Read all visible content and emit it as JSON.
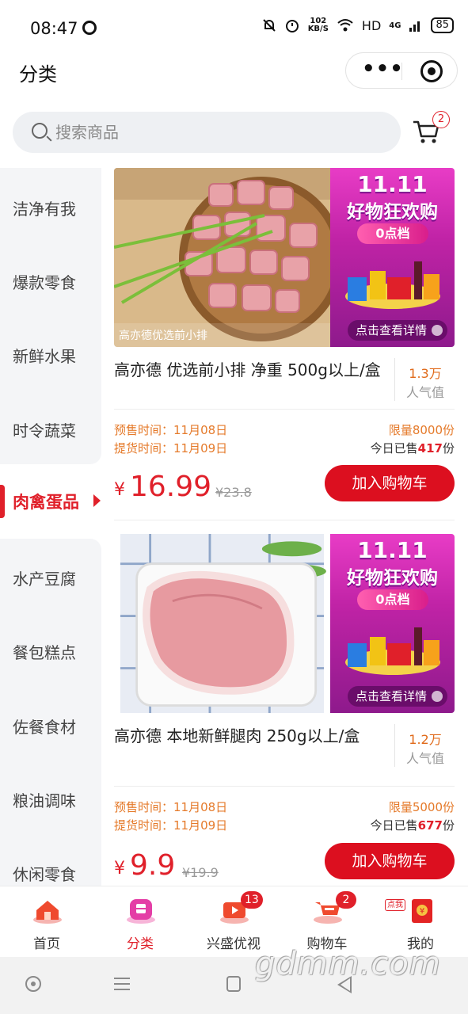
{
  "status_bar": {
    "time": "08:47",
    "net_speed_value": "102",
    "net_speed_unit": "KB/S",
    "hd": "HD",
    "signal": "4G",
    "battery": "85"
  },
  "header": {
    "title": "分类"
  },
  "search": {
    "placeholder": "搜索商品",
    "cart_badge": "2"
  },
  "sidebar": {
    "items": [
      "洁净有我",
      "爆款零食",
      "新鲜水果",
      "时令蔬菜",
      "肉禽蛋品",
      "水产豆腐",
      "餐包糕点",
      "佐餐食材",
      "粮油调味",
      "休闲零食"
    ],
    "active": "肉禽蛋品"
  },
  "promo": {
    "line1": "11.11",
    "line2": "好物狂欢购",
    "line3": "0点档",
    "line4": "点击查看详情"
  },
  "products": [
    {
      "image_caption": "高亦德优选前小排",
      "name": "高亦德 优选前小排 净重 500g以上/盒",
      "popularity": "1.3万",
      "popularity_label": "人气值",
      "presale": "预售时间：11月08日",
      "pickup": "提货时间：11月09日",
      "limit": "限量8000份",
      "sold_prefix": "今日已售",
      "sold_count": "417",
      "sold_suffix": "份",
      "currency": "¥",
      "price": "16.99",
      "original_price": "¥23.8",
      "button": "加入购物车"
    },
    {
      "image_caption": "",
      "name": "高亦德 本地新鲜腿肉 250g以上/盒",
      "popularity": "1.2万",
      "popularity_label": "人气值",
      "presale": "预售时间：11月08日",
      "pickup": "提货时间：11月09日",
      "limit": "限量5000份",
      "sold_prefix": "今日已售",
      "sold_count": "677",
      "sold_suffix": "份",
      "currency": "¥",
      "price": "9.9",
      "original_price": "¥19.9",
      "button": "加入购物车"
    }
  ],
  "tabbar": {
    "tabs": [
      {
        "label": "首页",
        "icon": "home-icon"
      },
      {
        "label": "分类",
        "icon": "category-icon",
        "active": true
      },
      {
        "label": "兴盛优视",
        "icon": "tv-icon",
        "badge": "13"
      },
      {
        "label": "购物车",
        "icon": "cart-icon",
        "badge": "2"
      },
      {
        "label": "我的",
        "icon": "profile-icon",
        "tag": "点我"
      }
    ]
  },
  "watermark": "gdmm.com",
  "colors": {
    "accent": "#e0202a",
    "orange": "#e57a2a",
    "promo_pink": "#c023a6"
  }
}
